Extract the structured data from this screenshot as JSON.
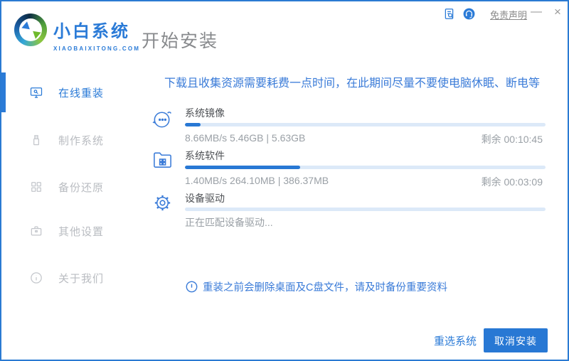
{
  "titlebar": {
    "disclaimer": "免责声明",
    "minimize_glyph": "—",
    "close_glyph": "×"
  },
  "header": {
    "brand_name": "小白系统",
    "brand_domain": "XIAOBAIXITONG.COM",
    "page_title": "开始安装"
  },
  "sidebar": {
    "items": [
      {
        "label": "在线重装",
        "icon": "monitor-icon",
        "active": true
      },
      {
        "label": "制作系统",
        "icon": "usb-icon",
        "active": false
      },
      {
        "label": "备份还原",
        "icon": "blocks-icon",
        "active": false
      },
      {
        "label": "其他设置",
        "icon": "toolbox-icon",
        "active": false
      },
      {
        "label": "关于我们",
        "icon": "info-icon",
        "active": false
      }
    ]
  },
  "main": {
    "notice": "下载且收集资源需要耗费一点时间，在此期间尽量不要使电脑休眠、断电等",
    "tasks": [
      {
        "name": "系统镜像",
        "icon": "face-icon",
        "progress_percent": 4.3,
        "detail": "8.66MB/s 5.46GB | 5.63GB",
        "remaining": "剩余 00:10:45"
      },
      {
        "name": "系统软件",
        "icon": "folder-icon",
        "progress_percent": 32,
        "detail": "1.40MB/s 264.10MB | 386.37MB",
        "remaining": "剩余 00:03:09"
      },
      {
        "name": "设备驱动",
        "icon": "gear-icon",
        "progress_percent": 0,
        "detail": "正在匹配设备驱动...",
        "remaining": ""
      }
    ],
    "note": "重装之前会删除桌面及C盘文件，请及时备份重要资料"
  },
  "footer": {
    "reselect_label": "重选系统",
    "cancel_label": "取消安装"
  },
  "colors": {
    "primary": "#2b7bd7",
    "progress_fill": "#2878d4",
    "progress_track": "#dce9f8",
    "notice_text": "#3a7bd8",
    "muted_text": "#9aa0a6",
    "inactive_sidebar": "#b9bcc1",
    "window_border": "#2a7ad2"
  }
}
